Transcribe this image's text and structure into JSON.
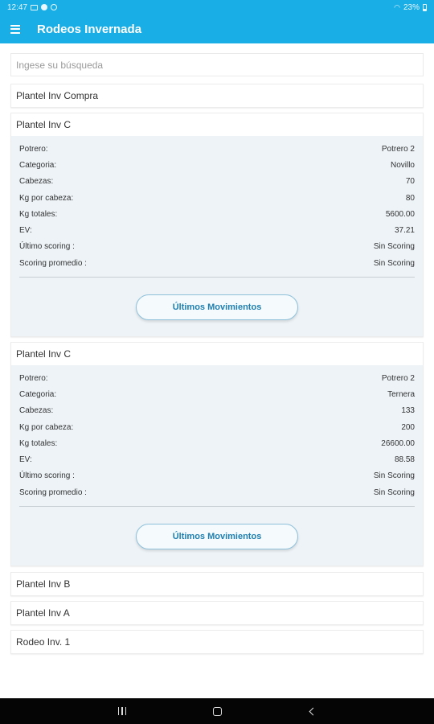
{
  "status_bar": {
    "time": "12:47",
    "battery": "23%"
  },
  "app_bar": {
    "title": "Rodeos Invernada"
  },
  "search": {
    "placeholder": "Ingese su búsqueda",
    "value": ""
  },
  "field_labels": {
    "potrero": "Potrero:",
    "categoria": "Categoria:",
    "cabezas": "Cabezas:",
    "kg_por_cabeza": "Kg por cabeza:",
    "kg_totales": "Kg totales:",
    "ev": "EV:",
    "ultimo_scoring": "Último scoring :",
    "scoring_promedio": "Scoring promedio :"
  },
  "items": [
    {
      "name": "Plantel Inv Compra"
    },
    {
      "name": "Plantel Inv C",
      "potrero": "Potrero 2",
      "categoria": "Novillo",
      "cabezas": "70",
      "kg_por_cabeza": "80",
      "kg_totales": "5600.00",
      "ev": "37.21",
      "ultimo_scoring": "Sin Scoring",
      "scoring_promedio": "Sin Scoring",
      "button_label": "Últimos Movimientos"
    },
    {
      "name": "Plantel Inv C",
      "potrero": "Potrero 2",
      "categoria": "Ternera",
      "cabezas": "133",
      "kg_por_cabeza": "200",
      "kg_totales": "26600.00",
      "ev": "88.58",
      "ultimo_scoring": "Sin Scoring",
      "scoring_promedio": "Sin Scoring",
      "button_label": "Últimos Movimientos"
    },
    {
      "name": "Plantel Inv B"
    },
    {
      "name": "Plantel Inv A"
    },
    {
      "name": "Rodeo Inv. 1"
    }
  ],
  "icons": {
    "menu": "hamburger-menu-icon",
    "recents": "recents-icon",
    "home": "home-icon",
    "back": "back-icon"
  },
  "colors": {
    "primary": "#1aaee6",
    "details_bg": "#edf3f7",
    "button_text": "#1f7fb0",
    "navbar": "#050505"
  }
}
